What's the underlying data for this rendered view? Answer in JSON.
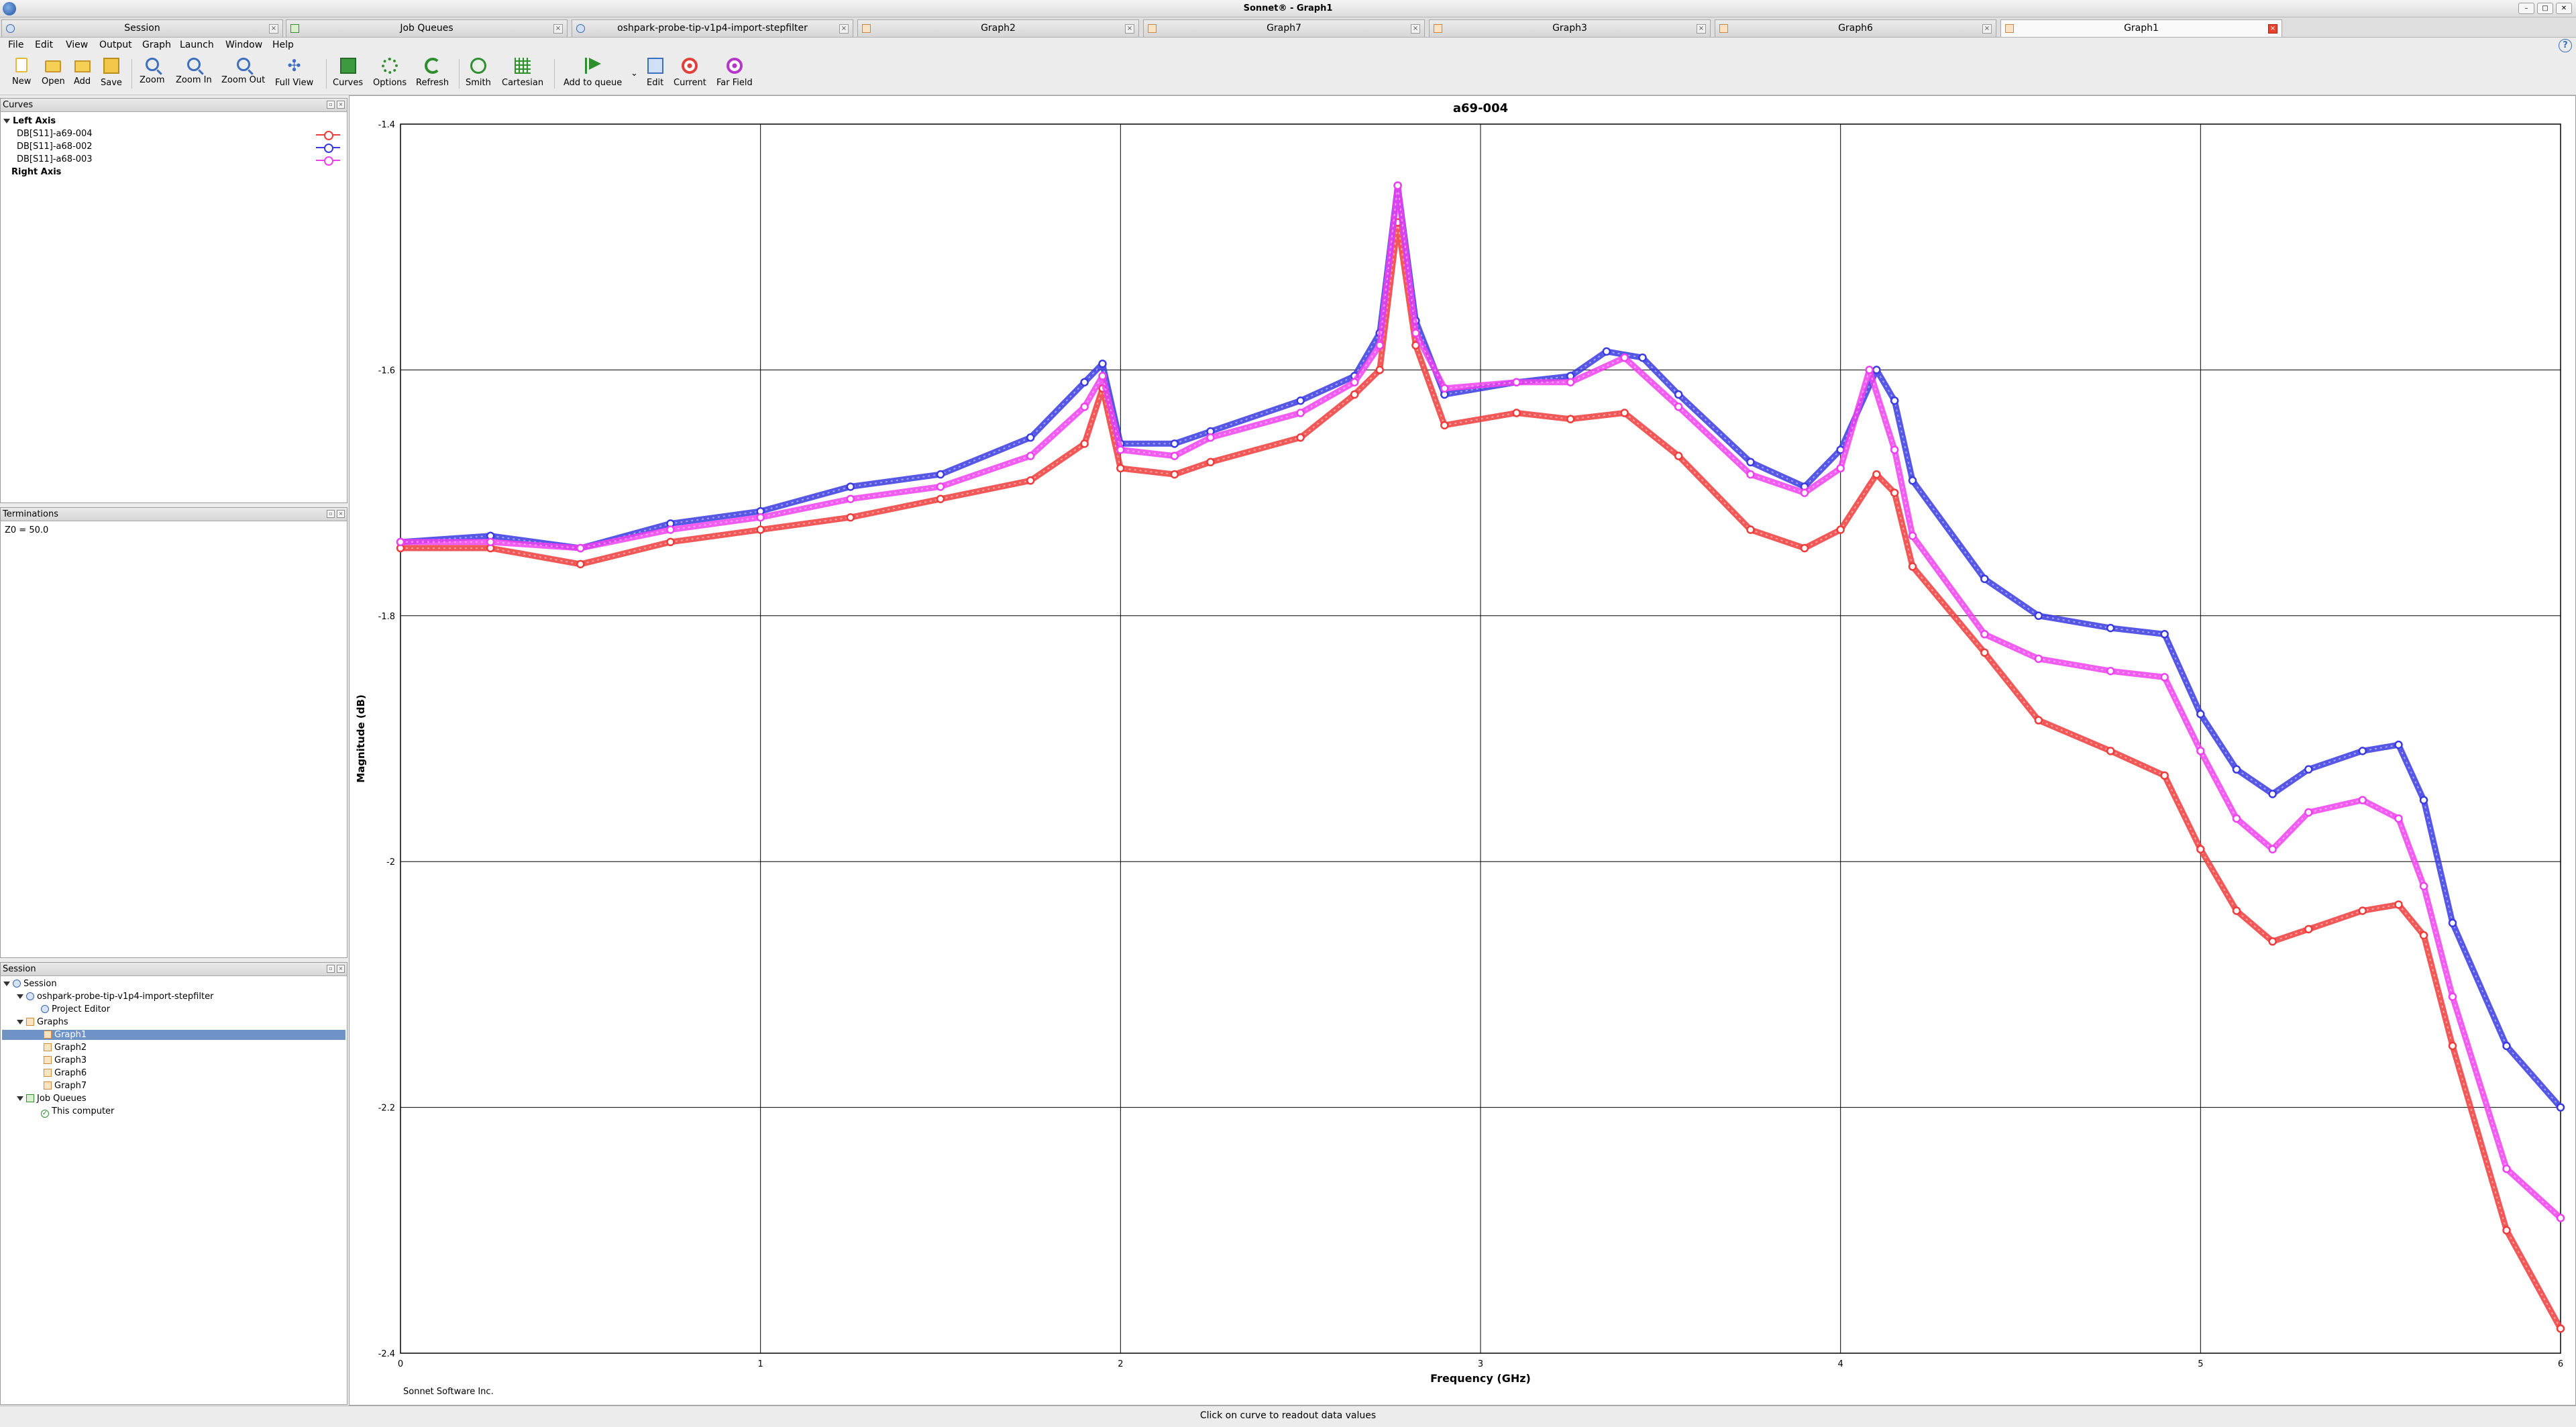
{
  "window": {
    "title": "Sonnet® - Graph1"
  },
  "tabs": [
    {
      "label": "Session",
      "icon": "session-icon"
    },
    {
      "label": "Job Queues",
      "icon": "queue-icon"
    },
    {
      "label": "oshpark-probe-tip-v1p4-import-stepfilter",
      "icon": "project-icon"
    },
    {
      "label": "Graph2",
      "icon": "graph-icon"
    },
    {
      "label": "Graph7",
      "icon": "graph-icon"
    },
    {
      "label": "Graph3",
      "icon": "graph-icon"
    },
    {
      "label": "Graph6",
      "icon": "graph-icon"
    },
    {
      "label": "Graph1",
      "icon": "graph-icon"
    }
  ],
  "menu": [
    "File",
    "Edit",
    "View",
    "Output",
    "Graph",
    "Launch",
    "Window",
    "Help"
  ],
  "toolbar": {
    "new": "New",
    "open": "Open",
    "add": "Add",
    "save": "Save",
    "zoom": "Zoom",
    "zoom_in": "Zoom In",
    "zoom_out": "Zoom Out",
    "full_view": "Full View",
    "curves": "Curves",
    "options": "Options",
    "refresh": "Refresh",
    "smith": "Smith",
    "cartesian": "Cartesian",
    "add_to_queue": "Add to queue",
    "edit": "Edit",
    "current": "Current",
    "far_field": "Far Field"
  },
  "curves_panel": {
    "title": "Curves",
    "left_axis": "Left Axis",
    "right_axis": "Right Axis",
    "items": [
      {
        "label": "DB[S11]-a69-004",
        "color": "#ee3b3b"
      },
      {
        "label": "DB[S11]-a68-002",
        "color": "#3a3ae0"
      },
      {
        "label": "DB[S11]-a68-003",
        "color": "#ee40ee"
      }
    ]
  },
  "terminations_panel": {
    "title": "Terminations",
    "value": "Z0 = 50.0"
  },
  "session_panel": {
    "title": "Session",
    "root": "Session",
    "project": "oshpark-probe-tip-v1p4-import-stepfilter",
    "project_editor": "Project Editor",
    "graphs_label": "Graphs",
    "graphs": [
      "Graph1",
      "Graph2",
      "Graph3",
      "Graph6",
      "Graph7"
    ],
    "job_queues": "Job Queues",
    "this_computer": "This computer"
  },
  "chart_data": {
    "type": "line",
    "title": "a69-004",
    "xlabel": "Frequency (GHz)",
    "ylabel": "Magnitude (dB)",
    "xlim": [
      0,
      6
    ],
    "ylim": [
      -2.4,
      -1.4
    ],
    "xticks": [
      "0",
      "1",
      "2",
      "3",
      "4",
      "5",
      "6"
    ],
    "yticks": [
      "-1.4",
      "-1.6",
      "-1.8",
      "-2",
      "-2.2",
      "-2.4"
    ],
    "grid": true,
    "footer": "Sonnet Software Inc.",
    "series": [
      {
        "name": "DB[S11]-a69-004",
        "color": "#ee3b3b",
        "x": [
          0,
          0.25,
          0.5,
          0.75,
          1.0,
          1.25,
          1.5,
          1.75,
          1.9,
          1.95,
          2.0,
          2.15,
          2.25,
          2.5,
          2.65,
          2.72,
          2.77,
          2.82,
          2.9,
          3.1,
          3.25,
          3.4,
          3.55,
          3.75,
          3.9,
          4.0,
          4.1,
          4.15,
          4.2,
          4.4,
          4.55,
          4.75,
          4.9,
          5.0,
          5.1,
          5.2,
          5.3,
          5.45,
          5.55,
          5.62,
          5.7,
          5.85,
          6.0
        ],
        "values": [
          -1.745,
          -1.745,
          -1.758,
          -1.74,
          -1.73,
          -1.72,
          -1.705,
          -1.69,
          -1.66,
          -1.615,
          -1.68,
          -1.685,
          -1.675,
          -1.655,
          -1.62,
          -1.6,
          -1.48,
          -1.58,
          -1.645,
          -1.635,
          -1.64,
          -1.635,
          -1.67,
          -1.73,
          -1.745,
          -1.73,
          -1.685,
          -1.7,
          -1.76,
          -1.83,
          -1.885,
          -1.91,
          -1.93,
          -1.99,
          -2.04,
          -2.065,
          -2.055,
          -2.04,
          -2.035,
          -2.06,
          -2.15,
          -2.3,
          -2.38
        ]
      },
      {
        "name": "DB[S11]-a68-002",
        "color": "#3a3ae0",
        "x": [
          0,
          0.25,
          0.5,
          0.75,
          1.0,
          1.25,
          1.5,
          1.75,
          1.9,
          1.95,
          2.0,
          2.15,
          2.25,
          2.5,
          2.65,
          2.72,
          2.77,
          2.82,
          2.9,
          3.1,
          3.25,
          3.35,
          3.45,
          3.55,
          3.75,
          3.9,
          4.0,
          4.1,
          4.15,
          4.2,
          4.4,
          4.55,
          4.75,
          4.9,
          5.0,
          5.1,
          5.2,
          5.3,
          5.45,
          5.55,
          5.62,
          5.7,
          5.85,
          6.0
        ],
        "values": [
          -1.74,
          -1.735,
          -1.745,
          -1.725,
          -1.715,
          -1.695,
          -1.685,
          -1.655,
          -1.61,
          -1.595,
          -1.66,
          -1.66,
          -1.65,
          -1.625,
          -1.605,
          -1.57,
          -1.45,
          -1.56,
          -1.62,
          -1.61,
          -1.605,
          -1.585,
          -1.59,
          -1.62,
          -1.675,
          -1.695,
          -1.665,
          -1.6,
          -1.625,
          -1.69,
          -1.77,
          -1.8,
          -1.81,
          -1.815,
          -1.88,
          -1.925,
          -1.945,
          -1.925,
          -1.91,
          -1.905,
          -1.95,
          -2.05,
          -2.15,
          -2.2
        ]
      },
      {
        "name": "DB[S11]-a68-003",
        "color": "#ee40ee",
        "x": [
          0,
          0.25,
          0.5,
          0.75,
          1.0,
          1.25,
          1.5,
          1.75,
          1.9,
          1.95,
          2.0,
          2.15,
          2.25,
          2.5,
          2.65,
          2.72,
          2.77,
          2.82,
          2.9,
          3.1,
          3.25,
          3.4,
          3.55,
          3.75,
          3.9,
          4.0,
          4.08,
          4.15,
          4.2,
          4.4,
          4.55,
          4.75,
          4.9,
          5.0,
          5.1,
          5.2,
          5.3,
          5.45,
          5.55,
          5.62,
          5.7,
          5.85,
          6.0
        ],
        "values": [
          -1.74,
          -1.74,
          -1.745,
          -1.73,
          -1.72,
          -1.705,
          -1.695,
          -1.67,
          -1.63,
          -1.605,
          -1.665,
          -1.67,
          -1.655,
          -1.635,
          -1.61,
          -1.58,
          -1.45,
          -1.57,
          -1.615,
          -1.61,
          -1.61,
          -1.59,
          -1.63,
          -1.685,
          -1.7,
          -1.68,
          -1.6,
          -1.665,
          -1.735,
          -1.815,
          -1.835,
          -1.845,
          -1.85,
          -1.91,
          -1.965,
          -1.99,
          -1.96,
          -1.95,
          -1.965,
          -2.02,
          -2.11,
          -2.25,
          -2.29
        ]
      }
    ]
  },
  "status": {
    "message": "Click on curve to readout data values"
  }
}
